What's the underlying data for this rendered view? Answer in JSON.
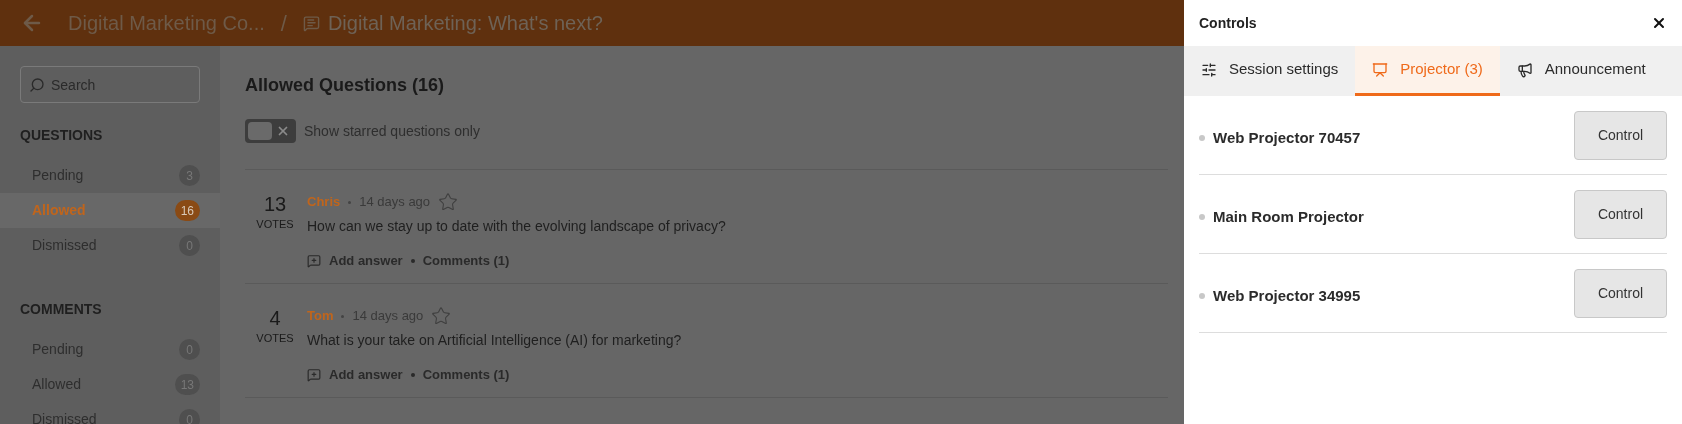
{
  "header": {
    "breadcrumb": "Digital Marketing Co...",
    "separator": "/",
    "title": "Digital Marketing: What's next?"
  },
  "sidebar": {
    "search": {
      "placeholder": "Search"
    },
    "sections": [
      {
        "title": "QUESTIONS",
        "items": [
          {
            "label": "Pending",
            "count": "3",
            "selected": false
          },
          {
            "label": "Allowed",
            "count": "16",
            "selected": true
          },
          {
            "label": "Dismissed",
            "count": "0",
            "selected": false
          }
        ]
      },
      {
        "title": "COMMENTS",
        "items": [
          {
            "label": "Pending",
            "count": "0",
            "selected": false
          },
          {
            "label": "Allowed",
            "count": "13",
            "selected": false
          },
          {
            "label": "Dismissed",
            "count": "0",
            "selected": false
          }
        ]
      }
    ]
  },
  "main": {
    "title": "Allowed Questions (16)",
    "starred_toggle": {
      "label": "Show starred questions only",
      "on": false
    },
    "questions": [
      {
        "votes": "13",
        "votes_label": "VOTES",
        "author": "Chris",
        "time": "14 days ago",
        "starred": false,
        "text": "How can we stay up to date with the evolving landscape of privacy?",
        "add_answer": "Add answer",
        "comments": "Comments (1)"
      },
      {
        "votes": "4",
        "votes_label": "VOTES",
        "author": "Tom",
        "time": "14 days ago",
        "starred": false,
        "text": "What is your take on Artificial Intelligence (AI) for marketing?",
        "add_answer": "Add answer",
        "comments": "Comments (1)"
      }
    ]
  },
  "panel": {
    "title": "Controls",
    "tabs": [
      {
        "label": "Session settings",
        "kind": "settings",
        "selected": false
      },
      {
        "label": "Projector (3)",
        "kind": "projector",
        "selected": true
      },
      {
        "label": "Announcement",
        "kind": "megaphone",
        "selected": false
      }
    ],
    "projectors": [
      {
        "name": "Web Projector 70457",
        "button": "Control"
      },
      {
        "name": "Main Room Projector",
        "button": "Control"
      },
      {
        "name": "Web Projector 34995",
        "button": "Control"
      }
    ]
  }
}
